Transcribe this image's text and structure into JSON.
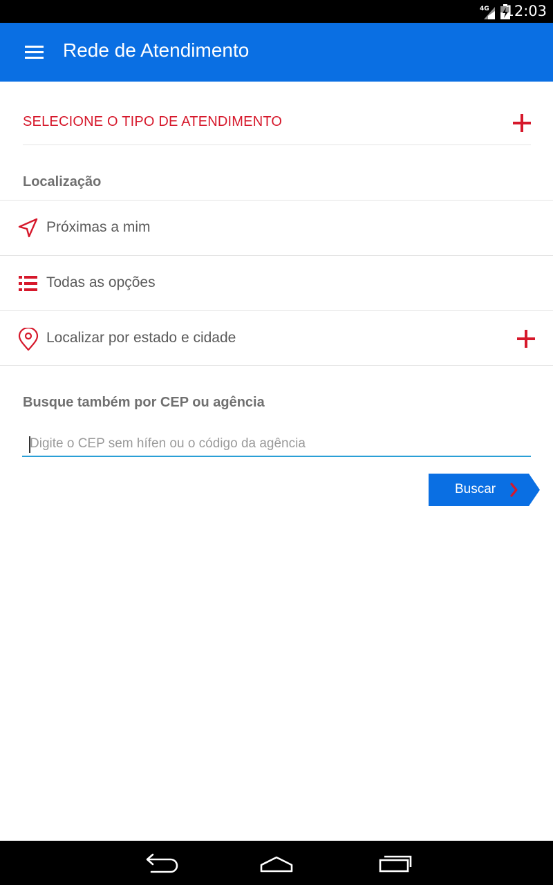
{
  "status_bar": {
    "network": "4G",
    "time": "12:03"
  },
  "app_bar": {
    "title": "Rede de Atendimento",
    "menu_icon": "hamburger-menu-icon"
  },
  "service_type": {
    "label": "SELECIONE O TIPO DE ATENDIMENTO",
    "icon": "plus-icon"
  },
  "location": {
    "title": "Localização",
    "options": [
      {
        "label": "Próximas a mim",
        "icon": "navigation-arrow-icon"
      },
      {
        "label": "Todas as opções",
        "icon": "list-icon"
      },
      {
        "label": "Localizar por estado e cidade",
        "icon": "map-pin-icon",
        "action_icon": "plus-icon"
      }
    ]
  },
  "search": {
    "title": "Busque também por CEP ou agência",
    "placeholder": "Digite o CEP sem hífen ou o código da agência",
    "value": "",
    "button_label": "Buscar"
  },
  "colors": {
    "primary": "#0a6fe3",
    "accent": "#d6182b",
    "input_underline": "#2a9fd6"
  },
  "nav_bar": {
    "buttons": [
      "back-icon",
      "home-icon",
      "recent-apps-icon"
    ]
  }
}
